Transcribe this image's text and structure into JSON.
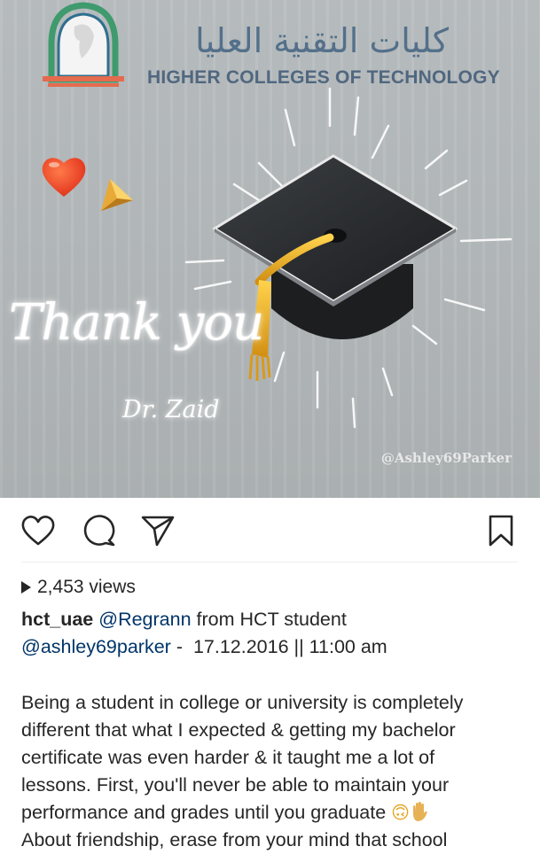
{
  "media": {
    "logo_arabic": "كليات التقنية العليا",
    "logo_english": "HIGHER COLLEGES OF TECHNOLOGY",
    "thank_you_text": "Thank you",
    "doctor_name": "Dr. Zaid",
    "watermark": "@Ashley69Parker",
    "icons": [
      "heart-emoji",
      "arrow-emoji",
      "graduation-cap"
    ]
  },
  "actions": {
    "icons": [
      "heart-icon",
      "comment-icon",
      "share-icon",
      "bookmark-icon"
    ]
  },
  "views": {
    "label": "2,453 views"
  },
  "caption": {
    "username": "hct_uae",
    "mention_regrann": "@Regrann",
    "text_from": " from HCT student",
    "mention_student": "@ashley69parker",
    "separator": " -  ",
    "date": "17.12.2016",
    "divider": " || ",
    "time": "11:00 am"
  },
  "body": {
    "line1": "Being a student in college or university is completely",
    "line2": "different that what I expected & getting my bachelor",
    "line3": "certificate was even harder & it taught me a lot of",
    "line4": "lessons. First, you'll never be able to maintain your",
    "line5": "performance and grades until you graduate",
    "line5_emojis": "🙃",
    "line6": "About friendship, erase from your mind that school"
  }
}
